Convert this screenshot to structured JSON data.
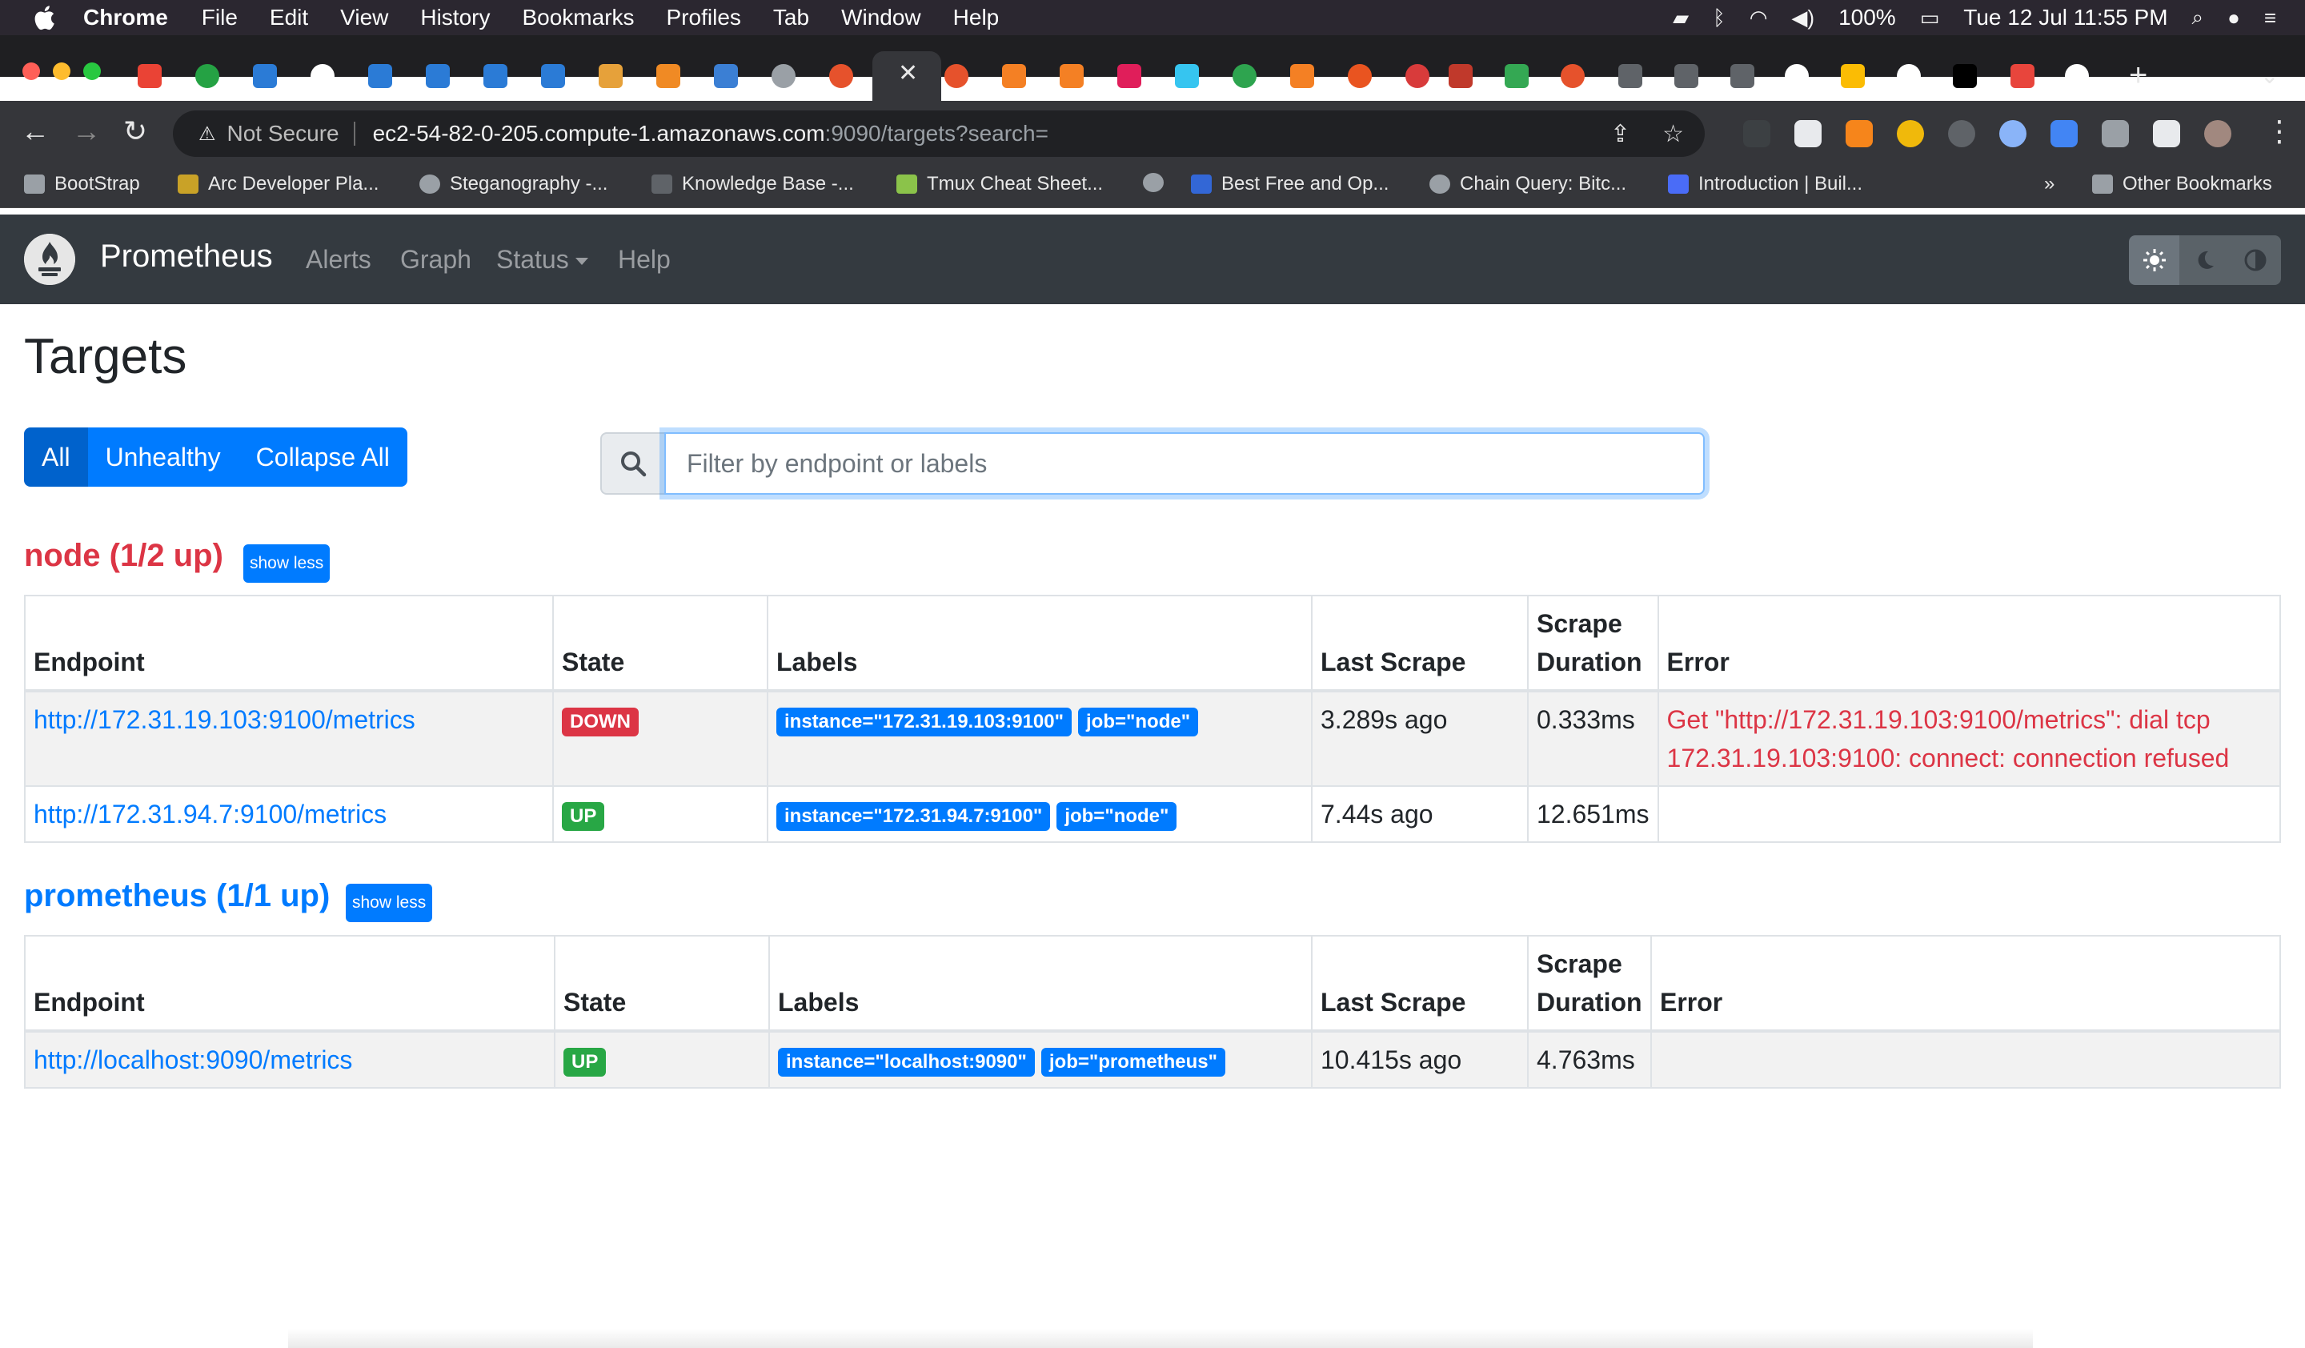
{
  "menubar": {
    "app": "Chrome",
    "items": [
      "File",
      "Edit",
      "View",
      "History",
      "Bookmarks",
      "Profiles",
      "Tab",
      "Window",
      "Help"
    ],
    "battery": "100%",
    "clock": "Tue 12 Jul  11:55 PM"
  },
  "browser": {
    "security_label": "Not Secure",
    "url_host": "ec2-54-82-0-205.compute-1.amazonaws.com",
    "url_path": ":9090/targets?search="
  },
  "bookmarks": {
    "items": [
      {
        "label": "BootStrap"
      },
      {
        "label": "Arc Developer Pla..."
      },
      {
        "label": "Steganography -..."
      },
      {
        "label": "Knowledge Base -..."
      },
      {
        "label": "Tmux Cheat Sheet..."
      },
      {
        "label": "Best Free and Op..."
      },
      {
        "label": "Chain Query: Bitc..."
      },
      {
        "label": "Introduction | Buil..."
      }
    ],
    "overflow": "»",
    "other": "Other Bookmarks"
  },
  "prometheus_nav": {
    "brand": "Prometheus",
    "links": [
      "Alerts",
      "Graph",
      "Status",
      "Help"
    ]
  },
  "page": {
    "title": "Targets",
    "filters": {
      "all": "All",
      "unhealthy": "Unhealthy",
      "collapse": "Collapse All"
    },
    "search_placeholder": "Filter by endpoint or labels"
  },
  "columns": {
    "endpoint": "Endpoint",
    "state": "State",
    "labels": "Labels",
    "last_scrape": "Last Scrape",
    "scrape_duration": "Scrape Duration",
    "error": "Error"
  },
  "pools": [
    {
      "title": "node (1/2 up)",
      "toggle": "show less",
      "targets": [
        {
          "endpoint": "http://172.31.19.103:9100/metrics",
          "state": "DOWN",
          "labels": [
            "instance=\"172.31.19.103:9100\"",
            "job=\"node\""
          ],
          "last_scrape": "3.289s ago",
          "scrape_duration": "0.333ms",
          "error": "Get \"http://172.31.19.103:9100/metrics\": dial tcp 172.31.19.103:9100: connect: connection refused"
        },
        {
          "endpoint": "http://172.31.94.7:9100/metrics",
          "state": "UP",
          "labels": [
            "instance=\"172.31.94.7:9100\"",
            "job=\"node\""
          ],
          "last_scrape": "7.44s ago",
          "scrape_duration": "12.651ms",
          "error": ""
        }
      ]
    },
    {
      "title": "prometheus (1/1 up)",
      "toggle": "show less",
      "targets": [
        {
          "endpoint": "http://localhost:9090/metrics",
          "state": "UP",
          "labels": [
            "instance=\"localhost:9090\"",
            "job=\"prometheus\""
          ],
          "last_scrape": "10.415s ago",
          "scrape_duration": "4.763ms",
          "error": ""
        }
      ]
    }
  ],
  "colors": {
    "primary": "#007bff",
    "danger": "#dc3545",
    "success": "#28a745",
    "navbar": "#343a40"
  }
}
